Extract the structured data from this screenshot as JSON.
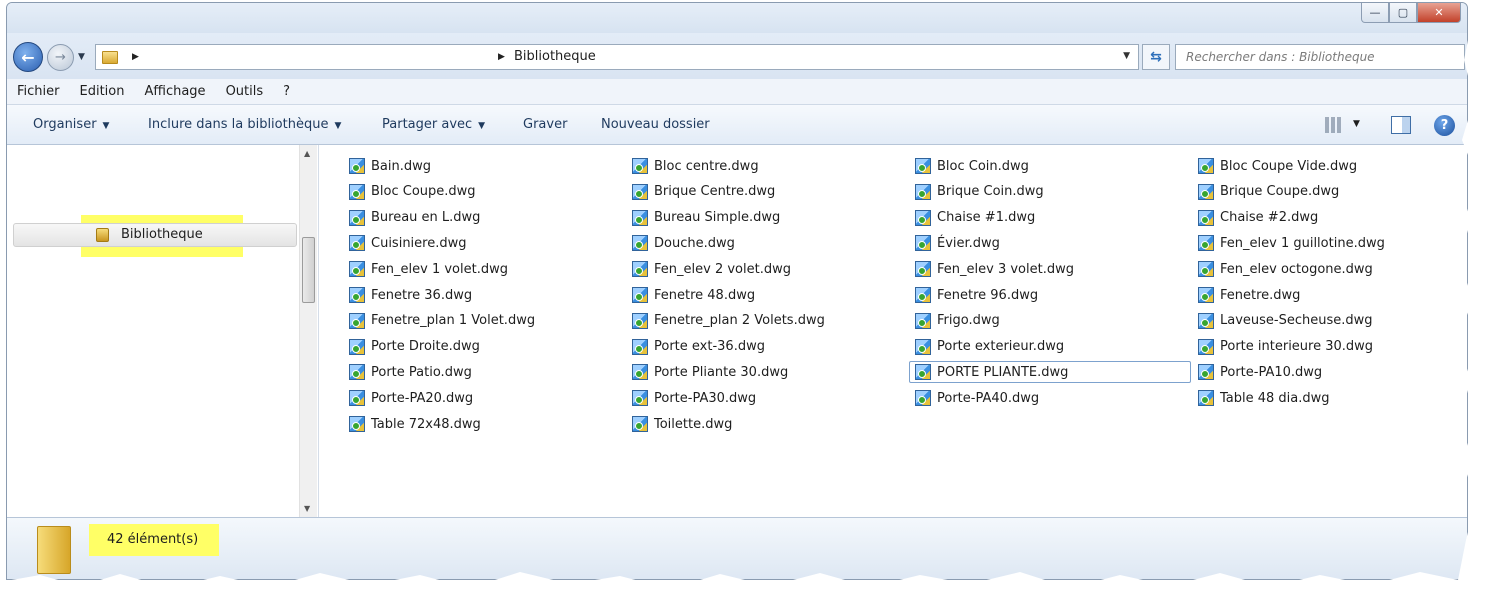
{
  "window": {
    "controls": {
      "minimize": "—",
      "maximize": "▢",
      "close": "✕"
    }
  },
  "address": {
    "path": "Bibliotheque",
    "search_placeholder": "Rechercher dans : Bibliotheque"
  },
  "menu": [
    "Fichier",
    "Edition",
    "Affichage",
    "Outils",
    "?"
  ],
  "toolbar": {
    "organiser": "Organiser",
    "inclure": "Inclure dans la bibliothèque",
    "partager": "Partager avec",
    "graver": "Graver",
    "nouveau_dossier": "Nouveau dossier"
  },
  "nav": {
    "selected": "Bibliotheque"
  },
  "files": [
    [
      "Bain.dwg",
      "Bloc Coupe.dwg",
      "Bureau en L.dwg",
      "Cuisiniere.dwg",
      "Fen_elev 1 volet.dwg",
      "Fenetre 36.dwg",
      "Fenetre_plan 1 Volet.dwg",
      "Porte Droite.dwg",
      "Porte Patio.dwg",
      "Porte-PA20.dwg",
      "Table 72x48.dwg"
    ],
    [
      "Bloc centre.dwg",
      "Brique Centre.dwg",
      "Bureau Simple.dwg",
      "Douche.dwg",
      "Fen_elev 2 volet.dwg",
      "Fenetre 48.dwg",
      "Fenetre_plan 2 Volets.dwg",
      "Porte ext-36.dwg",
      "Porte Pliante 30.dwg",
      "Porte-PA30.dwg",
      "Toilette.dwg"
    ],
    [
      "Bloc Coin.dwg",
      "Brique Coin.dwg",
      "Chaise #1.dwg",
      "Évier.dwg",
      "Fen_elev 3 volet.dwg",
      "Fenetre 96.dwg",
      "Frigo.dwg",
      "Porte exterieur.dwg",
      "PORTE PLIANTE.dwg",
      "Porte-PA40.dwg"
    ],
    [
      "Bloc Coupe Vide.dwg",
      "Brique Coupe.dwg",
      "Chaise #2.dwg",
      "Fen_elev 1 guillotine.dwg",
      "Fen_elev octogone.dwg",
      "Fenetre.dwg",
      "Laveuse-Secheuse.dwg",
      "Porte interieure 30.dwg",
      "Porte-PA10.dwg",
      "Table 48 dia.dwg"
    ]
  ],
  "selected_file": "PORTE PLIANTE.dwg",
  "status": {
    "count": "42 élément(s)"
  },
  "colors": {
    "highlight": "#ffff66",
    "selection_border": "#7da2ce"
  }
}
